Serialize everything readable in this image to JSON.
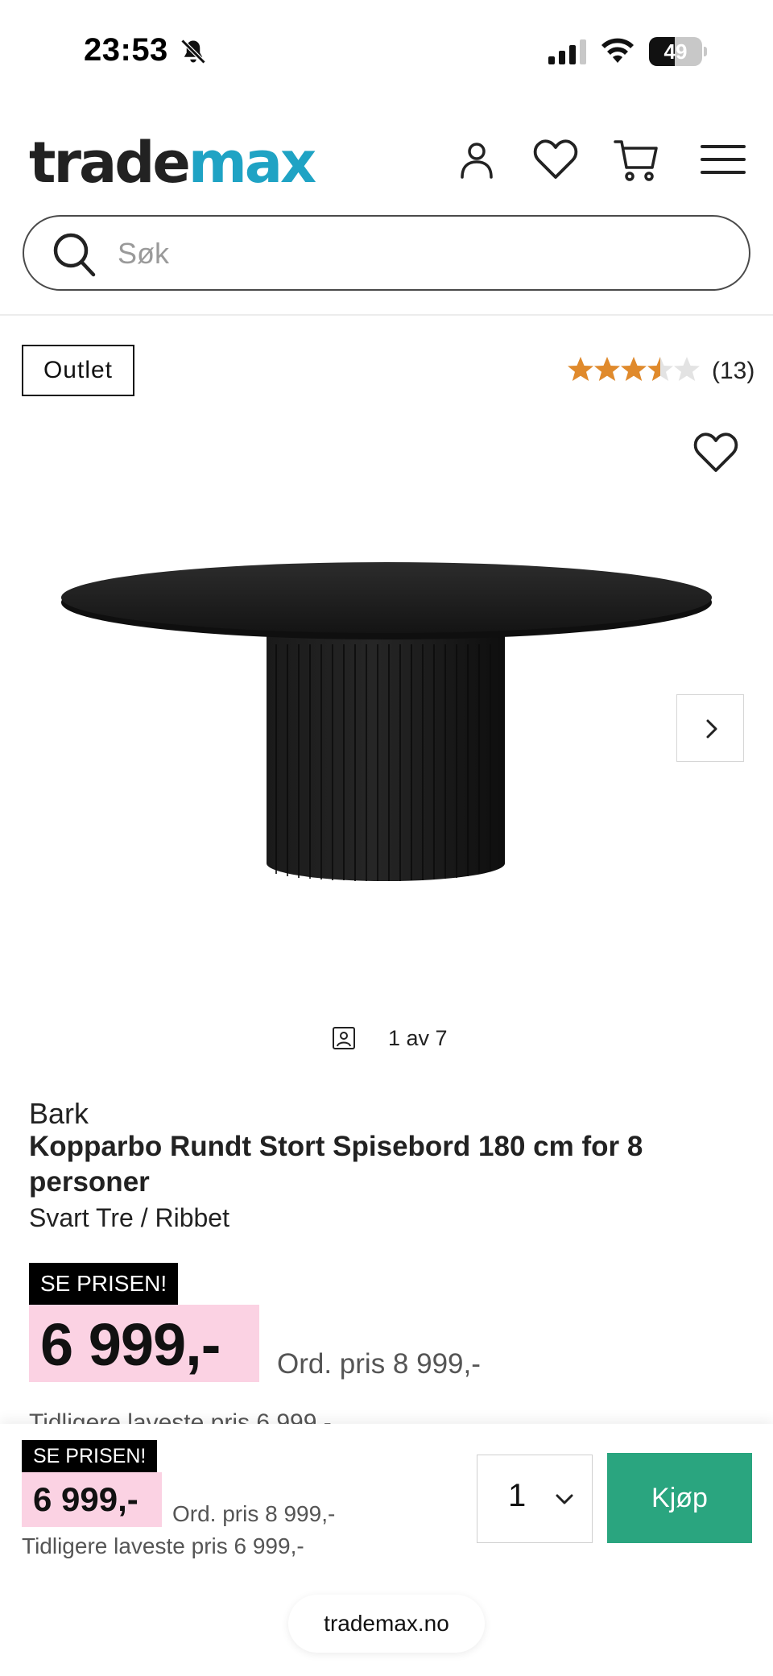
{
  "status_bar": {
    "time": "23:53",
    "battery_level": "49",
    "battery_fraction": 0.49,
    "icons": [
      "bell-slash-icon",
      "cellular-signal-icon",
      "wifi-icon",
      "battery-icon"
    ]
  },
  "header": {
    "logo_part1": "trade",
    "logo_part2": "max",
    "icons": [
      "user-icon",
      "heart-icon",
      "cart-icon",
      "menu-icon"
    ]
  },
  "search": {
    "placeholder": "Søk",
    "value": ""
  },
  "product": {
    "badge": "Outlet",
    "rating_value": 3.5,
    "rating_max": 5,
    "rating_count": "(13)",
    "gallery_counter": "1 av 7",
    "brand": "Bark",
    "title": "Kopparbo Rundt Stort Spisebord 180 cm for 8 personer",
    "variant": "Svart Tre / Ribbet",
    "promo_label": "SE PRISEN!",
    "price": "6 999,-",
    "ord_price": "Ord. pris 8 999,-",
    "previous_lowest": "Tidligere laveste pris 6 999,-"
  },
  "sticky_bar": {
    "promo_label": "SE PRISEN!",
    "price": "6 999,-",
    "ord_price": "Ord. pris 8 999,-",
    "previous_lowest": "Tidligere laveste pris 6 999,-",
    "quantity": "1",
    "buy_label": "Kjøp"
  },
  "browser": {
    "url": "trademax.no"
  },
  "colors": {
    "brand_teal": "#1fa3c4",
    "buy_green": "#2aa57f",
    "price_pink": "#fbd2e3",
    "star_orange": "#e08a2c"
  }
}
